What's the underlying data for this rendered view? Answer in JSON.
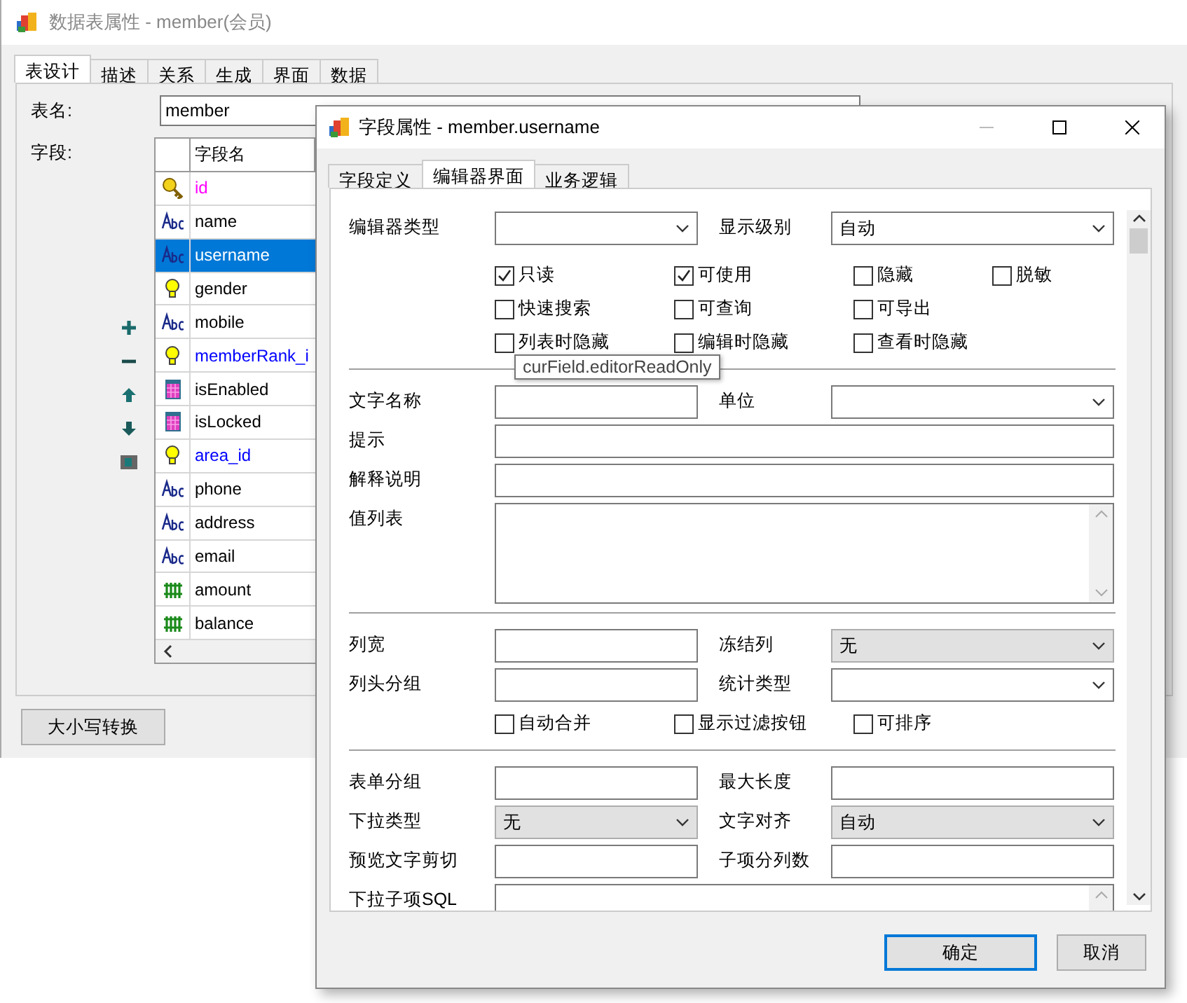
{
  "main_window": {
    "title": "数据表属性 - member(会员)",
    "tabs": [
      {
        "label": "表设计",
        "selected": true
      },
      {
        "label": "描述",
        "selected": false
      },
      {
        "label": "关系",
        "selected": false
      },
      {
        "label": "生成",
        "selected": false
      },
      {
        "label": "界面",
        "selected": false
      },
      {
        "label": "数据",
        "selected": false
      }
    ],
    "table_name_label": "表名:",
    "table_name": "member",
    "fields_label": "字段:",
    "grid": {
      "columns": [
        "字段名"
      ],
      "rows": [
        {
          "kind": "key",
          "name": "id",
          "color": "#ff00ff",
          "selected": false
        },
        {
          "kind": "text",
          "name": "name",
          "color": "#000000",
          "selected": false
        },
        {
          "kind": "text",
          "name": "username",
          "selected": true
        },
        {
          "kind": "bool",
          "name": "gender",
          "color": "#000000",
          "selected": false
        },
        {
          "kind": "text",
          "name": "mobile",
          "color": "#000000",
          "selected": false
        },
        {
          "kind": "bool",
          "name": "memberRank_i",
          "color": "#0000ff",
          "selected": false
        },
        {
          "kind": "calc",
          "name": "isEnabled",
          "color": "#000000",
          "selected": false
        },
        {
          "kind": "calc",
          "name": "isLocked",
          "color": "#000000",
          "selected": false
        },
        {
          "kind": "bool",
          "name": "area_id",
          "color": "#0000ff",
          "selected": false
        },
        {
          "kind": "text",
          "name": "phone",
          "color": "#000000",
          "selected": false
        },
        {
          "kind": "text",
          "name": "address",
          "color": "#000000",
          "selected": false
        },
        {
          "kind": "text",
          "name": "email",
          "color": "#000000",
          "selected": false
        },
        {
          "kind": "number",
          "name": "amount",
          "color": "#000000",
          "selected": false
        },
        {
          "kind": "number",
          "name": "balance",
          "color": "#000000",
          "selected": false
        }
      ]
    },
    "convert_button": "大小写转换"
  },
  "dialog": {
    "title": "字段属性 - member.username",
    "tabs": [
      {
        "label": "字段定义",
        "selected": false
      },
      {
        "label": "编辑器界面",
        "selected": true
      },
      {
        "label": "业务逻辑",
        "selected": false
      }
    ],
    "sections": [
      [
        {
          "kind": "pair",
          "items": [
            {
              "label": "编辑器类型",
              "control": {
                "kind": "select",
                "editable": true
              }
            },
            {
              "label": "显示级别",
              "control": {
                "kind": "select",
                "value": "自动",
                "editable": true
              }
            }
          ]
        },
        {
          "kind": "checks",
          "items": [
            {
              "label": "只读",
              "checked": true
            },
            {
              "label": "可使用",
              "checked": true
            },
            {
              "label": "隐藏",
              "checked": false
            },
            {
              "label": "脱敏",
              "checked": false
            }
          ]
        },
        {
          "kind": "checks",
          "items": [
            {
              "label": "快速搜索",
              "checked": false
            },
            {
              "label": "可查询",
              "checked": false
            },
            {
              "label": "可导出",
              "checked": false
            }
          ]
        },
        {
          "kind": "checks",
          "items": [
            {
              "label": "列表时隐藏",
              "checked": false
            },
            {
              "label": "编辑时隐藏",
              "checked": false
            },
            {
              "label": "查看时隐藏",
              "checked": false
            }
          ]
        }
      ],
      [
        {
          "kind": "pair",
          "items": [
            {
              "label": "文字名称",
              "control": {
                "kind": "text"
              }
            },
            {
              "label": "单位",
              "control": {
                "kind": "select",
                "editable": true
              }
            }
          ]
        },
        {
          "kind": "wide",
          "label": "提示",
          "control": {
            "kind": "text"
          }
        },
        {
          "kind": "wide",
          "label": "解释说明",
          "control": {
            "kind": "text"
          }
        },
        {
          "kind": "wide",
          "label": "值列表",
          "control": {
            "kind": "textarea"
          }
        }
      ],
      [
        {
          "kind": "pair",
          "items": [
            {
              "label": "列宽",
              "control": {
                "kind": "text"
              }
            },
            {
              "label": "冻结列",
              "control": {
                "kind": "select",
                "value": "无",
                "editable": false
              }
            }
          ]
        },
        {
          "kind": "pair",
          "items": [
            {
              "label": "列头分组",
              "control": {
                "kind": "text"
              }
            },
            {
              "label": "统计类型",
              "control": {
                "kind": "select",
                "editable": true
              }
            }
          ]
        },
        {
          "kind": "checks",
          "items": [
            {
              "label": "自动合并",
              "checked": false
            },
            {
              "label": "显示过滤按钮",
              "checked": false
            },
            {
              "label": "可排序",
              "checked": false
            }
          ]
        }
      ],
      [
        {
          "kind": "pair",
          "items": [
            {
              "label": "表单分组",
              "control": {
                "kind": "text"
              }
            },
            {
              "label": "最大长度",
              "control": {
                "kind": "text"
              }
            }
          ]
        },
        {
          "kind": "pair",
          "items": [
            {
              "label": "下拉类型",
              "control": {
                "kind": "select",
                "value": "无",
                "editable": false
              }
            },
            {
              "label": "文字对齐",
              "control": {
                "kind": "select",
                "value": "自动",
                "editable": false
              }
            }
          ]
        },
        {
          "kind": "pair",
          "items": [
            {
              "label": "预览文字剪切",
              "control": {
                "kind": "text"
              }
            },
            {
              "label": "子项分列数",
              "control": {
                "kind": "text"
              }
            }
          ]
        },
        {
          "kind": "wide",
          "label": "下拉子项SQL",
          "control": {
            "kind": "textarea"
          }
        }
      ]
    ],
    "buttons": [
      {
        "label": "确定",
        "default": true
      },
      {
        "label": "取消",
        "default": false
      }
    ]
  },
  "tooltip": "curField.editorReadOnly"
}
